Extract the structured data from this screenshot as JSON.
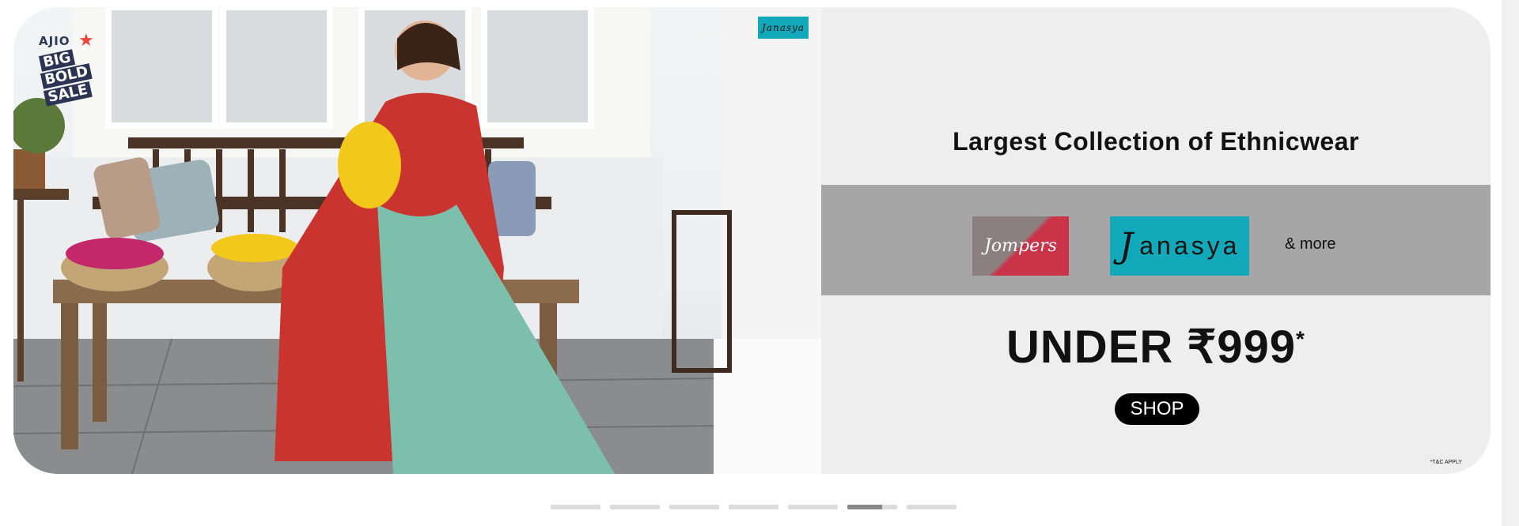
{
  "banner": {
    "sale_logo": {
      "brand": "AJIO",
      "words": [
        "BIG",
        "BOLD",
        "SALE"
      ],
      "icon": "star-icon"
    },
    "corner_brand_tag": "Janasya",
    "headline": "Largest Collection of Ethnicwear",
    "brands": [
      {
        "name": "Jompers",
        "colors": [
          "#8c7f7f",
          "#c93449"
        ]
      },
      {
        "name": "anasya",
        "initial": "J",
        "color": "#12a9ba"
      }
    ],
    "more_label": "& more",
    "price_text": "UNDER ₹999",
    "price_asterisk": "*",
    "cta_label": "SHOP",
    "tnc": "*T&C APPLY"
  },
  "carousel": {
    "total_slides": 7,
    "active_index": 5,
    "active_progress": 0.7
  },
  "colors": {
    "panel_bg": "#eeeeee",
    "band_bg": "#a6a6a6",
    "cta_bg": "#000000",
    "janasya_teal": "#12a9ba"
  }
}
